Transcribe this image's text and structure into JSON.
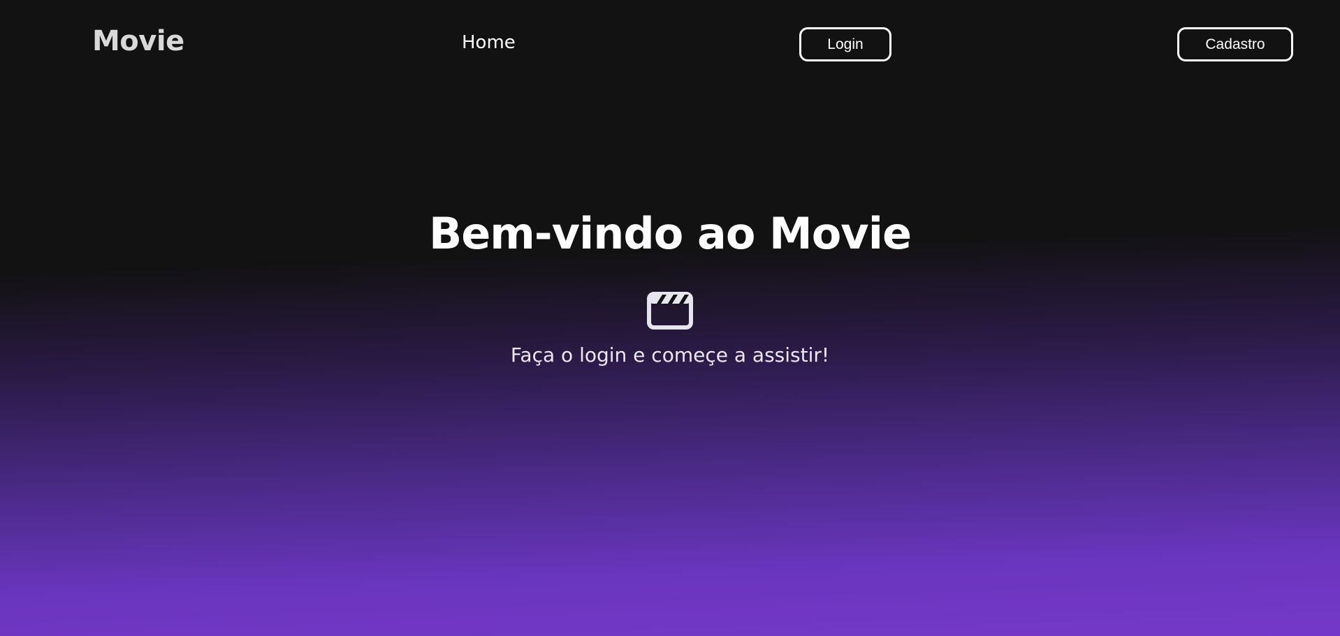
{
  "nav": {
    "brand": "Movie",
    "home_label": "Home",
    "login_label": "Login",
    "cadastro_label": "Cadastro"
  },
  "hero": {
    "title": "Bem-vindo ao Movie",
    "icon": "clapperboard-icon",
    "subtitle": "Faça o login e começe a assistir!"
  },
  "colors": {
    "background_top": "#121212",
    "background_bottom": "#7538c8",
    "text": "#ffffff",
    "brand_text": "#d9d9d9"
  }
}
